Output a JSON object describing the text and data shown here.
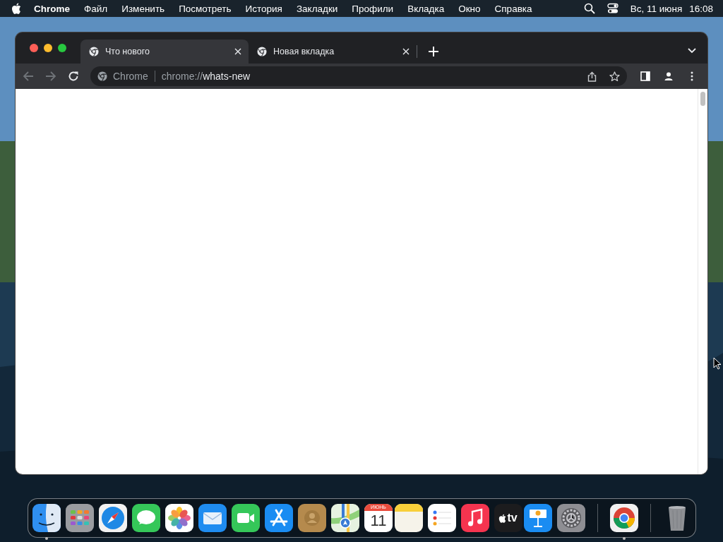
{
  "menu_bar": {
    "app_name": "Chrome",
    "menus": [
      "Файл",
      "Изменить",
      "Посмотреть",
      "История",
      "Закладки",
      "Профили",
      "Вкладка",
      "Окно",
      "Справка"
    ],
    "date": "Вс, 11 июня",
    "time": "16:08"
  },
  "browser": {
    "tabs": [
      {
        "title": "Что нового",
        "selected": true
      },
      {
        "title": "Новая вкладка",
        "selected": false
      }
    ],
    "address_bar": {
      "chip": "Chrome",
      "url_scheme": "chrome://",
      "url_path": "whats-new"
    },
    "back_enabled": false,
    "forward_enabled": false
  },
  "dock": {
    "items": [
      {
        "kind": "finder",
        "running": true
      },
      {
        "kind": "launchpad",
        "running": false
      },
      {
        "kind": "safari",
        "running": false
      },
      {
        "kind": "messages",
        "running": false
      },
      {
        "kind": "photos",
        "running": false
      },
      {
        "kind": "mail",
        "running": false
      },
      {
        "kind": "facetime",
        "running": false
      },
      {
        "kind": "appstore",
        "running": false
      },
      {
        "kind": "contacts",
        "running": false
      },
      {
        "kind": "maps",
        "running": false
      },
      {
        "kind": "calendar",
        "running": false,
        "month": "ИЮНЬ",
        "day": "11"
      },
      {
        "kind": "notes",
        "running": false
      },
      {
        "kind": "reminders",
        "running": false
      },
      {
        "kind": "music",
        "running": false
      },
      {
        "kind": "tv",
        "running": false,
        "label": "tv"
      },
      {
        "kind": "keynote",
        "running": false
      },
      {
        "kind": "settings",
        "running": false
      },
      {
        "kind": "separator"
      },
      {
        "kind": "chrome",
        "running": true
      },
      {
        "kind": "separator"
      },
      {
        "kind": "trash",
        "running": false
      }
    ]
  }
}
